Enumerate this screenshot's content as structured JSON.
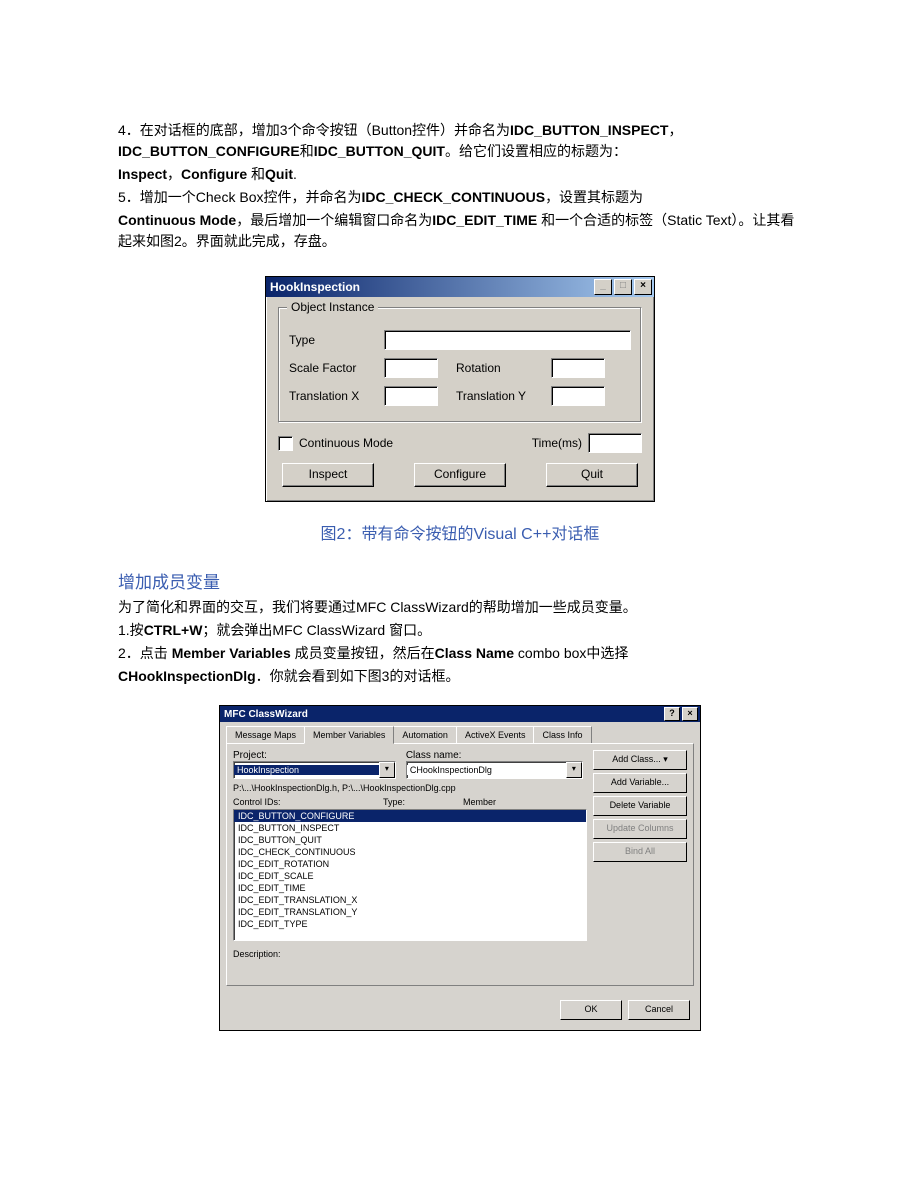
{
  "para4": {
    "prefix": "4．在对话框的底部，增加3个命令按钮（Button控件）并命名为",
    "b1": "IDC_BUTTON_INSPECT",
    "sep1": "，",
    "b2": "IDC_BUTTON_CONFIGURE",
    "and": "和",
    "b3": "IDC_BUTTON_QUIT",
    "suffix": "。给它们设置相应的标题为：",
    "line2a": "Inspect",
    "line2b": "，",
    "line2c": "Configure",
    "line2d": " 和",
    "line2e": "Quit",
    "line2f": "."
  },
  "para5": {
    "prefix": "5．增加一个Check Box控件，并命名为",
    "b1": "IDC_CHECK_CONTINUOUS",
    "mid1": "，设置其标题为",
    "line2a": "Continuous Mode",
    "line2b": "，最后增加一个编辑窗口命名为",
    "line2c": "IDC_EDIT_TIME",
    "line2d": " 和一个合适的标签（Static Text）。让其看起来如图2。界面就此完成，存盘。"
  },
  "dlg1": {
    "title": "HookInspection",
    "group": "Object Instance",
    "l_type": "Type",
    "l_scale": "Scale Factor",
    "l_rot": "Rotation",
    "l_tx": "Translation X",
    "l_ty": "Translation Y",
    "l_cont": "Continuous Mode",
    "l_time": "Time(ms)",
    "btn_inspect": "Inspect",
    "btn_configure": "Configure",
    "btn_quit": "Quit"
  },
  "caption1": "图2：带有命令按钮的Visual C++对话框",
  "section": "增加成员变量",
  "intro": "为了简化和界面的交互，我们将要通过MFC ClassWizard的帮助增加一些成员变量。",
  "step1a": "1.按",
  "step1b": "CTRL+W",
  "step1c": "；就会弹出MFC ClassWizard  窗口。",
  "step2a": "2．点击 ",
  "step2b": "Member Variables",
  "step2c": " 成员变量按钮，然后在",
  "step2d": "Class Name",
  "step2e": " combo box中选择",
  "step2f": "CHookInspectionDlg",
  "step2g": "．你就会看到如下图3的对话框。",
  "dlg2": {
    "title": "MFC ClassWizard",
    "tabs": [
      "Message Maps",
      "Member Variables",
      "Automation",
      "ActiveX Events",
      "Class Info"
    ],
    "project_label": "Project:",
    "project_value": "HookInspection",
    "classname_label": "Class name:",
    "classname_value": "CHookInspectionDlg",
    "path": "P:\\...\\HookInspectionDlg.h, P:\\...\\HookInspectionDlg.cpp",
    "control_label": "Control IDs:",
    "col_type": "Type:",
    "col_member": "Member",
    "btn_addclass": "Add Class...  ▾",
    "btn_addvar": "Add Variable...",
    "btn_delvar": "Delete Variable",
    "btn_updcol": "Update Columns",
    "btn_bindall": "Bind All",
    "items": [
      "IDC_BUTTON_CONFIGURE",
      "IDC_BUTTON_INSPECT",
      "IDC_BUTTON_QUIT",
      "IDC_CHECK_CONTINUOUS",
      "IDC_EDIT_ROTATION",
      "IDC_EDIT_SCALE",
      "IDC_EDIT_TIME",
      "IDC_EDIT_TRANSLATION_X",
      "IDC_EDIT_TRANSLATION_Y",
      "IDC_EDIT_TYPE"
    ],
    "descr_label": "Description:",
    "ok": "OK",
    "cancel": "Cancel"
  }
}
